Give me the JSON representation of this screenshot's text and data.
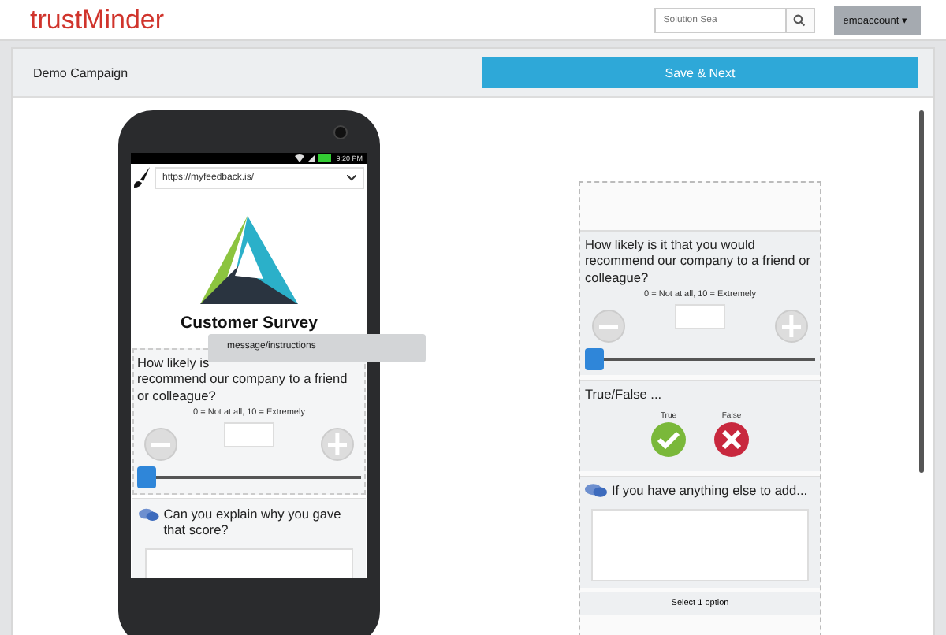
{
  "header": {
    "logo": "trustMinder",
    "search": {
      "placeholder": "Solution Sea"
    },
    "account": {
      "label": "emoaccount",
      "caret": "▾"
    }
  },
  "campaign": {
    "title": "Demo Campaign",
    "save_button": "Save & Next"
  },
  "phone": {
    "status_time": "9:20 PM",
    "url": "https://myfeedback.is/",
    "survey_title": "Customer Survey",
    "question": {
      "first_line": "How likely is",
      "rest": "recommend our company to a friend or colleague?",
      "scale_hint": "0 = Not at all, 10 = Extremely",
      "level": 0
    },
    "comment_prompt": "Can you explain why you gave that score?",
    "tooltip": "message/instructions"
  },
  "preview": {
    "question": {
      "text": "How likely is it that you would recommend our company to a friend or colleague?",
      "scale_hint": "0 = Not at all, 10 = Extremely",
      "level": 0
    },
    "true_false": {
      "title": "True/False ...",
      "options": [
        {
          "label": "True",
          "kind": "true"
        },
        {
          "label": "False",
          "kind": "false"
        }
      ]
    },
    "comment_prompt": "If you have anything else to add...",
    "footer": "Select 1 option"
  }
}
